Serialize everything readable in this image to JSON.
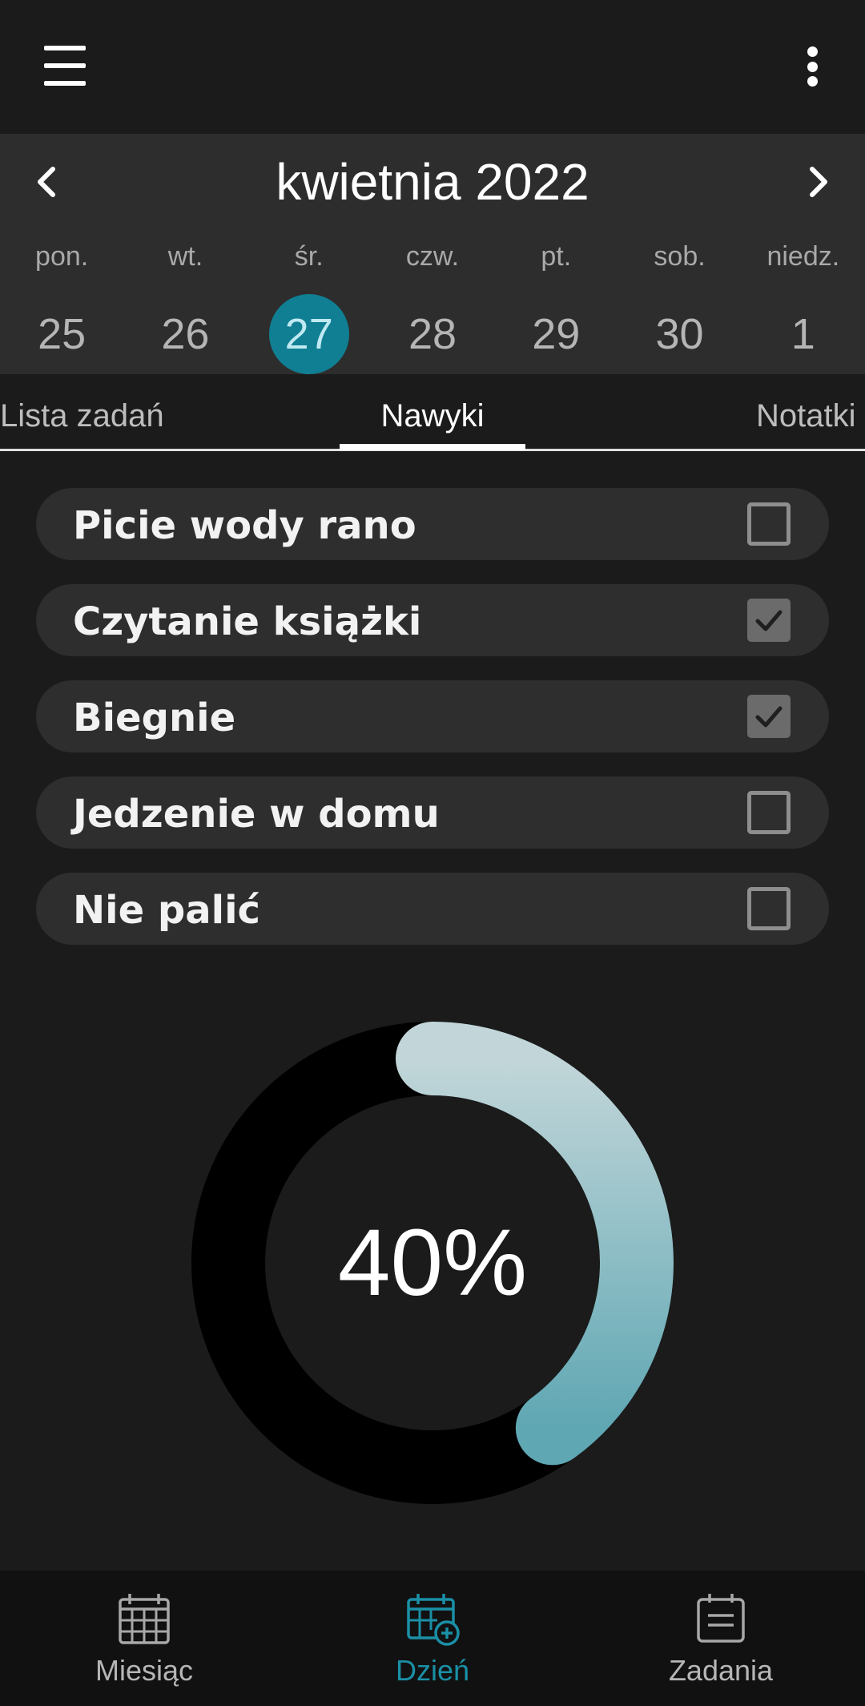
{
  "header": {
    "menu_icon": "hamburger-menu-icon",
    "overflow_icon": "more-vert-icon"
  },
  "calendar": {
    "month_title": "kwietnia 2022",
    "weekdays": [
      "pon.",
      "wt.",
      "śr.",
      "czw.",
      "pt.",
      "sob.",
      "niedz."
    ],
    "days": [
      "25",
      "26",
      "27",
      "28",
      "29",
      "30",
      "1"
    ],
    "selected_day": "27",
    "selected_color": "#107f93"
  },
  "tabs": {
    "items": [
      "Lista zadań",
      "Nawyki",
      "Notatki"
    ],
    "active": "Nawyki"
  },
  "habits": [
    {
      "label": "Picie wody rano",
      "checked": false
    },
    {
      "label": "Czytanie książki",
      "checked": true
    },
    {
      "label": "Biegnie",
      "checked": true
    },
    {
      "label": "Jedzenie w domu",
      "checked": false
    },
    {
      "label": "Nie palić",
      "checked": false
    }
  ],
  "progress": {
    "percent_label": "40%",
    "value": 0.4,
    "gradient_start": "#c2d6d9",
    "gradient_end": "#5fa7b3"
  },
  "bottom_nav": {
    "items": [
      {
        "label": "Miesiąc",
        "icon": "calendar-month-icon",
        "active": false
      },
      {
        "label": "Dzień",
        "icon": "calendar-add-icon",
        "active": true
      },
      {
        "label": "Zadania",
        "icon": "task-list-icon",
        "active": false
      }
    ],
    "active_color": "#1a8fa6"
  }
}
